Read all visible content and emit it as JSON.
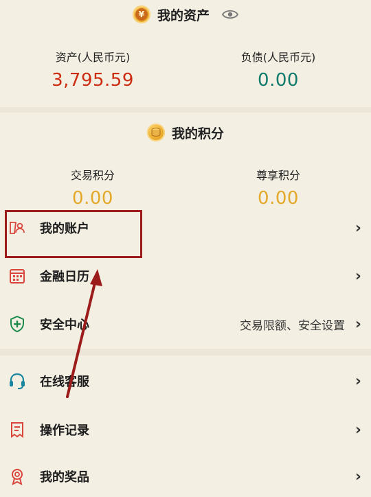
{
  "assets": {
    "title": "我的资产",
    "liabilities_label": "负债(人民币元)",
    "liabilities_value": "0.00",
    "assets_label": "资产(人民币元)",
    "assets_value": "3,795.59"
  },
  "points": {
    "title": "我的积分",
    "trade_label": "交易积分",
    "trade_value": "0.00",
    "premium_label": "尊享积分",
    "premium_value": "0.00"
  },
  "menu": {
    "account": "我的账户",
    "calendar": "金融日历",
    "security": "安全中心",
    "security_extra": "交易限额、安全设置",
    "service": "在线客服",
    "records": "操作记录",
    "rewards": "我的奖品",
    "chevron": "›"
  },
  "colors": {
    "assets_value": "#cc2c12",
    "liabilities_value": "#107a6b",
    "points_value": "#e4a92b",
    "icon_red": "#d9453d",
    "icon_green": "#1b8a4a",
    "icon_teal": "#1a86a0",
    "annotation": "#9c1b1b"
  },
  "icons": {
    "assets_coin": "yen-coin-icon",
    "eye": "eye-icon",
    "points_coin": "coin-stack-icon",
    "account": "user-card-icon",
    "calendar": "calendar-icon",
    "security": "shield-plus-icon",
    "service": "headset-icon",
    "records": "document-list-icon",
    "rewards": "medal-icon",
    "annotation_arrow": "arrow-annotation-icon"
  }
}
